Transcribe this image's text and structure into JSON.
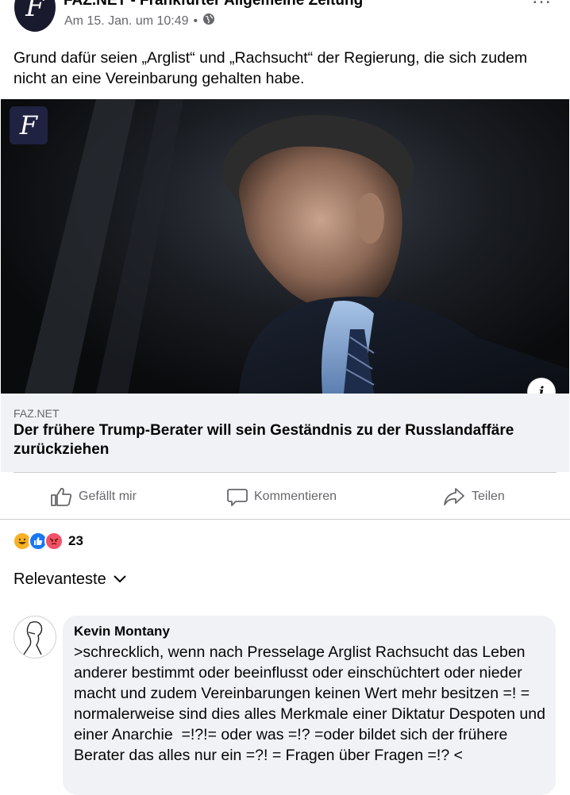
{
  "header": {
    "page_name": "FAZ.NET - Frankfurter Allgemeine Zeitung",
    "avatar_letter": "F",
    "timestamp": "Am 15. Jan. um 10:49",
    "separator": "•",
    "privacy_icon": "globe-icon",
    "more_icon": "more-options-icon",
    "more_glyph": "…"
  },
  "post": {
    "text": "Grund dafür seien „Arglist“ und „Rachsucht“ der Regierung, die sich zudem nicht an eine Vereinbarung gehalten habe."
  },
  "media": {
    "badge_letter": "F",
    "info_label": "i"
  },
  "link_preview": {
    "domain": "FAZ.NET",
    "title": "Der frühere Trump-Berater will sein Geständnis zu der Russlandaffäre zurückziehen"
  },
  "actions": {
    "like": "Gefällt mir",
    "comment": "Kommentieren",
    "share": "Teilen"
  },
  "reactions": {
    "icons": [
      "haha",
      "like",
      "angry"
    ],
    "count": "23"
  },
  "comments_sort": {
    "label": "Relevanteste"
  },
  "comments": [
    {
      "author": "Kevin Montany",
      "text": ">schrecklich, wenn nach Presselage Arglist Rachsucht das Leben anderer bestimmt oder beeinflusst oder einschüchtert oder nieder macht und zudem Vereinbarungen keinen Wert mehr besitzen =! = normalerweise sind dies alles Merkmale einer Diktatur Despoten und einer Anarchie  =!?!= oder was =!? =oder bildet sich der frühere Berater das alles nur ein =?! = Fragen über Fragen =!? <"
    }
  ],
  "colors": {
    "secondary_text": "#65676b",
    "link_bg": "#f0f2f5",
    "like_blue": "#1877f2",
    "angry_orange": "#f25268",
    "haha_yellow": "#f7b125"
  }
}
